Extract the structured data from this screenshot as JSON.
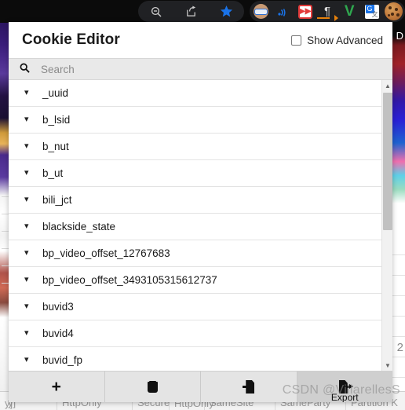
{
  "browser_toolbar": {
    "left_group": [
      {
        "name": "zoom-out-icon",
        "glyph": "⌕"
      },
      {
        "name": "share-icon",
        "glyph": "➦"
      },
      {
        "name": "bookmark-star-icon",
        "glyph": "★"
      }
    ],
    "right_group": [
      {
        "name": "avatar-glasses-icon",
        "label": ""
      },
      {
        "name": "wifi-cast-icon",
        "label": ")))"
      },
      {
        "name": "fast-forward-extension-icon",
        "label": "▶▶"
      },
      {
        "name": "pilcrow-arrow-icon",
        "label": "¶"
      },
      {
        "name": "vue-devtools-icon",
        "label": "V"
      },
      {
        "name": "google-translate-icon",
        "label": "G"
      },
      {
        "name": "cookie-editor-icon",
        "label": ""
      }
    ]
  },
  "popup": {
    "title": "Cookie Editor",
    "show_advanced_label": "Show Advanced",
    "show_advanced_checked": false,
    "search": {
      "placeholder": "Search",
      "value": "",
      "icon": "search-icon"
    },
    "cookies": [
      {
        "name": "_uuid"
      },
      {
        "name": "b_lsid"
      },
      {
        "name": "b_nut"
      },
      {
        "name": "b_ut"
      },
      {
        "name": "bili_jct"
      },
      {
        "name": "blackside_state"
      },
      {
        "name": "bp_video_offset_12767683"
      },
      {
        "name": "bp_video_offset_3493105315612737"
      },
      {
        "name": "buvid3"
      },
      {
        "name": "buvid4"
      },
      {
        "name": "buvid_fp"
      }
    ],
    "scrollbar": {
      "up_arrow": "▲",
      "down_arrow": "▼"
    },
    "footer_buttons": [
      {
        "name": "add-cookie-button",
        "icon": "plus-icon",
        "tooltip": ""
      },
      {
        "name": "delete-all-button",
        "icon": "trash-icon",
        "tooltip": ""
      },
      {
        "name": "import-button",
        "icon": "import-icon",
        "tooltip": ""
      },
      {
        "name": "export-button",
        "icon": "export-icon",
        "tooltip": "Export",
        "hovered": true
      }
    ]
  },
  "background": {
    "devtools_columns": [
      "y]",
      "HttpOnly",
      "Secure",
      "SameSite",
      "SameParty",
      "Partition K"
    ],
    "right_letter": "D",
    "right_number": "2",
    "left_letter": "y]"
  },
  "watermark": "CSDN @VillarellesS",
  "colors": {
    "accent_blue": "#1a73e8",
    "panel_bg": "#ffffff",
    "toolbar_bg": "#0b0b0b",
    "footer_bg": "#e4e4e4",
    "search_bg": "#e9e9e9",
    "row_border": "#e3e3e3"
  }
}
